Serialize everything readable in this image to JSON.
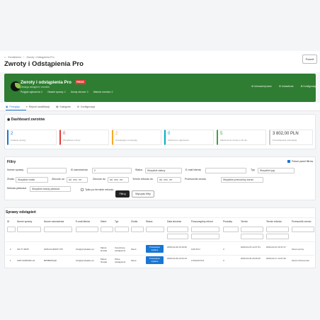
{
  "breadcrumb": [
    "Sendinlemo",
    "Zwroty i Odstąpienia Pro"
  ],
  "page_title": "Zwroty i Odstąpienia Pro",
  "back_button": "Powrót",
  "hero": {
    "title": "Zwroty i odstąpienia Pro",
    "badge": "PREZE",
    "subtitle": "Obsługa odstąpień i zwrotów",
    "stats": [
      "Przyjęte zgłoszenia: 2",
      "Otwarte sprawy: 2",
      "Zwroty zlecone: 0",
      "Wartość zwrotów: 0"
    ],
    "links": [
      "Unieważnij dane",
      "Ustawienia",
      "Konfiguracja"
    ]
  },
  "tabs": [
    "Przegląd",
    "Rejestr kwalifikacji",
    "Kategorie",
    "Konfiguracja"
  ],
  "dashboard": {
    "title": "Dashboard zwrotów",
    "stats": [
      {
        "value": "2",
        "label": "Ostatnie sprawy",
        "color": "#1976d2"
      },
      {
        "value": "0",
        "label": "Wysyłkowe zwroty",
        "color": "#e53935"
      },
      {
        "value": "2",
        "label": "Oczekujące na decyzję",
        "color": "#f9a825"
      },
      {
        "value": "0",
        "label": "Odrzucone zgłoszenia",
        "color": "#00acc1"
      },
      {
        "value": "5",
        "label": "Zakończone zwroty w 30 dni",
        "color": "#43a047"
      },
      {
        "value": "3 802,00 PLN",
        "label": "Przewidywana refundacja",
        "color": "#cccccc"
      }
    ]
  },
  "filters": {
    "title": "Filtry",
    "autofilter_label": "Pokaż panel filtrów",
    "order_label": "Numer sprawy",
    "order_id_label": "ID zamówienia",
    "order_id_value": "0",
    "status_label": "Status",
    "status_value": "Wszystkie statusy",
    "email_label": "E-mail klienta",
    "type_label": "Typ",
    "type_value": "Wszystkie typy",
    "source_label": "Źródło",
    "source_value": "Wszystkie źródła",
    "from_label": "Zlecone od",
    "from_placeholder": "dd . mm . rrrr",
    "to_label": "Zlecone do",
    "to_placeholder": "dd . mm . rrrr",
    "refund_from_label": "Termin refundu do",
    "refund_from_placeholder": "dd . mm . rrrr",
    "reason_label": "Przewoźnik zwrotu",
    "reason_value": "Wszystkie przewoźnicy zwrotu",
    "method_label": "Metoda płatności",
    "method_value": "Wszystkie metody płatności",
    "overdue_label": "Tylko po terminie refundu",
    "apply_button": "Filtruj",
    "clear_button": "Wyczyść filtry"
  },
  "table": {
    "title": "Sprawy odstąpień",
    "headers": [
      "ID",
      "Numer sprawy",
      "Numer zamówienia",
      "E-mail klienta",
      "Klient",
      "Typ",
      "Źródło",
      "Status",
      "Data zlecenia",
      "Poszczególny refund",
      "Produkty",
      "Termin",
      "Termin refundu",
      "Przewoźnik zwrotu"
    ],
    "rows": [
      {
        "id": "2",
        "case": "OR-77-6035",
        "order": "2026-04-000077-P5",
        "email": "info@przykladen.pl",
        "client": "Marek Nowak",
        "type": "Częściowe odstąpienie",
        "source": "Klient",
        "status": "Przekazanie wysłane",
        "date": "2026-04-03 20:19:36",
        "refund": "0,00 PLN",
        "products": "3",
        "deadline": "2026-04-15 12:27:51",
        "refund_deadline": "2026-04-10 16:37:27",
        "carrier": "Zwrot ręczny"
      },
      {
        "id": "1",
        "case": "ORP-20260403-24",
        "order": "BPMBWSQR",
        "email": "info@przykladen.pl",
        "client": "Marek Nowak",
        "type": "Pełne odstąpienie",
        "source": "Klient",
        "status": "Przekazanie wysłane",
        "date": "2026-04-03 22:22:16",
        "refund": "2 000,00 PLN",
        "products": "3",
        "deadline": "2026-04-26 20:26:26",
        "refund_deadline": "2026-04-17 14:07:20",
        "carrier": "Zwrot InPost kurier"
      }
    ]
  }
}
